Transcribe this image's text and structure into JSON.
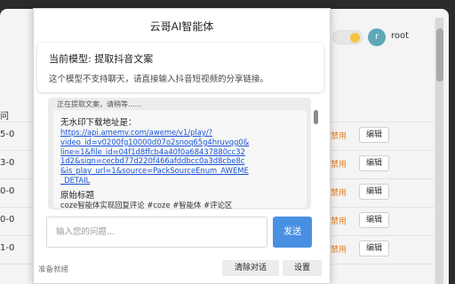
{
  "background": {
    "user": {
      "avatar_letter": "r",
      "name": "root"
    },
    "header_fragment": "问",
    "rows": [
      {
        "fragment": "5-0",
        "link": "禁用",
        "button": "编辑"
      },
      {
        "fragment": "3-0",
        "link": "禁用",
        "button": "编辑"
      },
      {
        "fragment": "0-0",
        "link": "禁用",
        "button": "编辑"
      },
      {
        "fragment": "0-0",
        "link": "禁用",
        "button": "编辑"
      },
      {
        "fragment": "1-0",
        "link": "禁用",
        "button": "编辑"
      }
    ]
  },
  "dialog": {
    "title": "云哥AI智能体",
    "model": {
      "title": "当前模型: 提取抖音文案",
      "subtitle": "这个模型不支持聊天，请直接输入抖音短视频的分享链接。"
    },
    "message": {
      "status": "正在提取文案，请稍等......",
      "download_label": "无水印下载地址是：",
      "download_link_lines": [
        "https://api.amemv.com/aweme/v1/play/?",
        "video_id=v0200fg10000d07o2snoq65g4hruvqg0&",
        "line=1&file_id=04f1d8ffcb4a40f0a68437880cc32",
        "1d2&sign=cecbd77d220f466afddbcc0a3d8cbe8c",
        "&is_play_url=1&source=PackSourceEnum_AWEME",
        "_DETAIL"
      ],
      "original_title_label": "原始标题",
      "original_title": "coze智能体实现回复评论 #coze #智能体 #评论区"
    },
    "input": {
      "placeholder": "输入您的问题...",
      "value": ""
    },
    "send_label": "发送",
    "footer": {
      "status": "准备就绪",
      "clear_label": "清除对话",
      "settings_label": "设置"
    }
  },
  "colors": {
    "accent": "#4a90e2",
    "link": "#1a55d6",
    "disable_link": "#e67e22"
  }
}
